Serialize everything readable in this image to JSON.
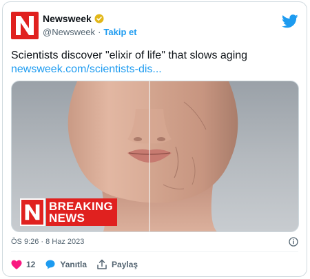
{
  "account": {
    "name": "Newsweek",
    "handle": "@Newsweek",
    "separator": "·",
    "follow_label": "Takip et"
  },
  "tweet": {
    "text": "Scientists discover \"elixir of life\" that slows aging",
    "link": "newsweek.com/scientists-dis...",
    "timestamp": "ÖS 9:26 · 8 Haz 2023"
  },
  "media": {
    "badge_line1": "BREAKING",
    "badge_line2": "NEWS"
  },
  "actions": {
    "like_count": "12",
    "reply_label": "Yanıtla",
    "share_label": "Paylaş"
  },
  "colors": {
    "brand_red": "#e0211f",
    "twitter_blue": "#1d9bf0",
    "like_pink": "#f91880"
  },
  "icons": [
    "newsweek-logo",
    "verified-badge-icon",
    "twitter-bird-icon",
    "info-icon",
    "heart-icon",
    "reply-bubble-icon",
    "share-icon"
  ]
}
